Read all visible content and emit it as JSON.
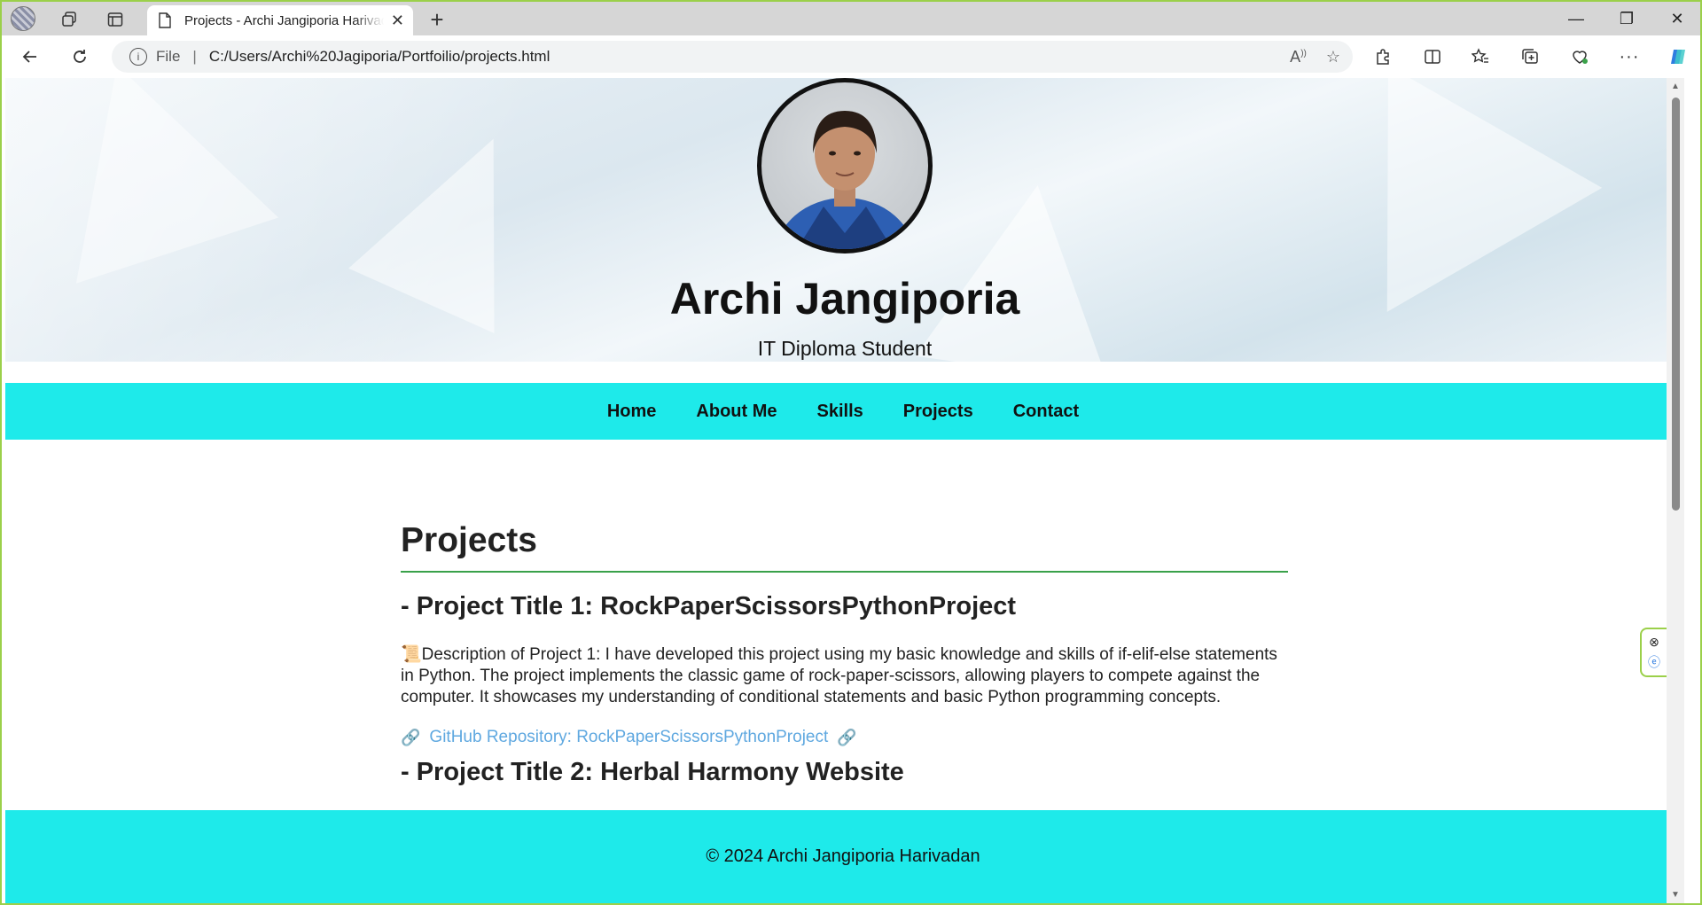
{
  "browser": {
    "tab_title": "Projects - Archi Jangiporia Harivadan",
    "address_label": "File",
    "url": "C:/Users/Archi%20Jagiporia/Portfoilio/projects.html"
  },
  "header": {
    "name": "Archi Jangiporia",
    "subtitle": "IT Diploma Student"
  },
  "nav": {
    "items": [
      {
        "label": "Home"
      },
      {
        "label": "About Me"
      },
      {
        "label": "Skills"
      },
      {
        "label": "Projects"
      },
      {
        "label": "Contact"
      }
    ]
  },
  "main": {
    "section_title": "Projects",
    "projects": [
      {
        "title": "- Project Title 1: RockPaperScissorsPythonProject",
        "description_icon": "📜",
        "description": "Description of Project 1: I have developed this project using my basic knowledge and skills of if-elif-else statements in Python. The project implements the classic game of rock-paper-scissors, allowing players to compete against the computer. It showcases my understanding of conditional statements and basic Python programming concepts.",
        "link_label": "GitHub Repository: RockPaperScissorsPythonProject"
      },
      {
        "title": "- Project Title 2: Herbal Harmony Website"
      }
    ]
  },
  "footer": {
    "text": "© 2024 Archi Jangiporia Harivadan"
  },
  "colors": {
    "nav_bg": "#1eeaea",
    "divider": "#3aa14a",
    "link": "#5fa8e0"
  }
}
